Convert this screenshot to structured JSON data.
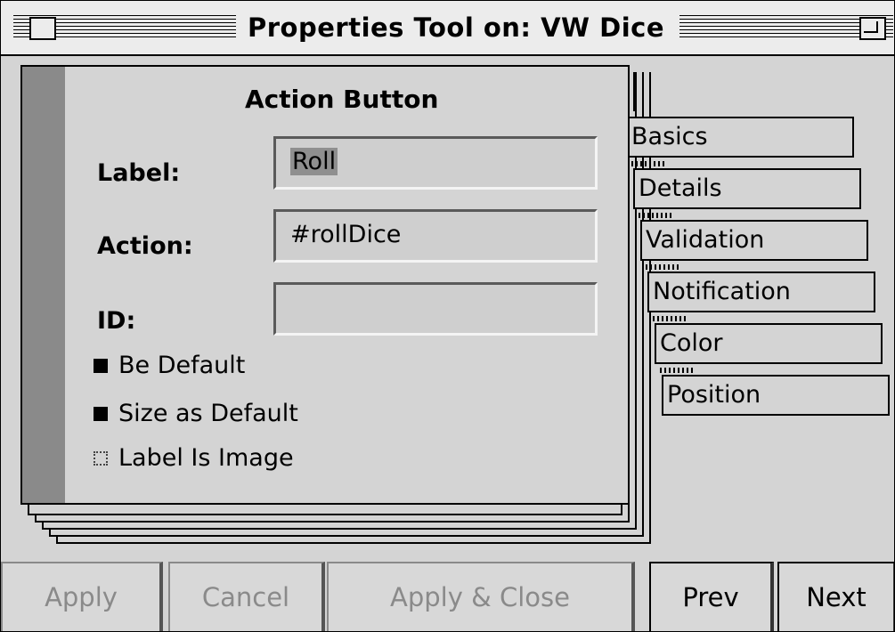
{
  "window": {
    "title": "Properties Tool on: VW Dice"
  },
  "page": {
    "section_title": "Action Button",
    "label_label": "Label:",
    "label_value": "Roll",
    "action_label": "Action:",
    "action_value": "#rollDice",
    "id_label": "ID:",
    "id_value": "",
    "checkboxes": [
      {
        "label": "Be Default",
        "checked": true
      },
      {
        "label": "Size as Default",
        "checked": true
      },
      {
        "label": "Label Is Image",
        "checked": false
      }
    ]
  },
  "tabs": [
    "Basics",
    "Details",
    "Validation",
    "Notification",
    "Color",
    "Position"
  ],
  "buttons": {
    "apply": "Apply",
    "cancel": "Cancel",
    "apply_close": "Apply & Close",
    "prev": "Prev",
    "next": "Next"
  }
}
